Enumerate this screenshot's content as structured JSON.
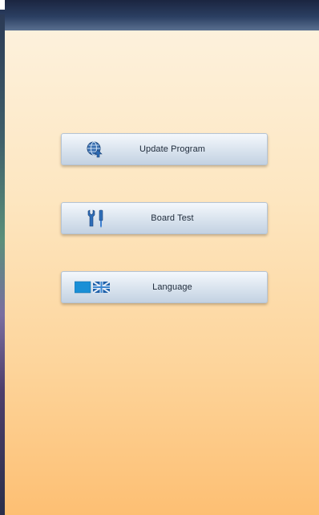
{
  "window": {
    "background_top": "#fdf1dc",
    "background_bottom": "#fdbf73",
    "titlebar_color": "#2b3f62"
  },
  "menu": {
    "items": [
      {
        "label": "Update Program",
        "icon": "globe-icon"
      },
      {
        "label": "Board Test",
        "icon": "tools-icon"
      },
      {
        "label": "Language",
        "icon": "flags-icon"
      }
    ]
  }
}
